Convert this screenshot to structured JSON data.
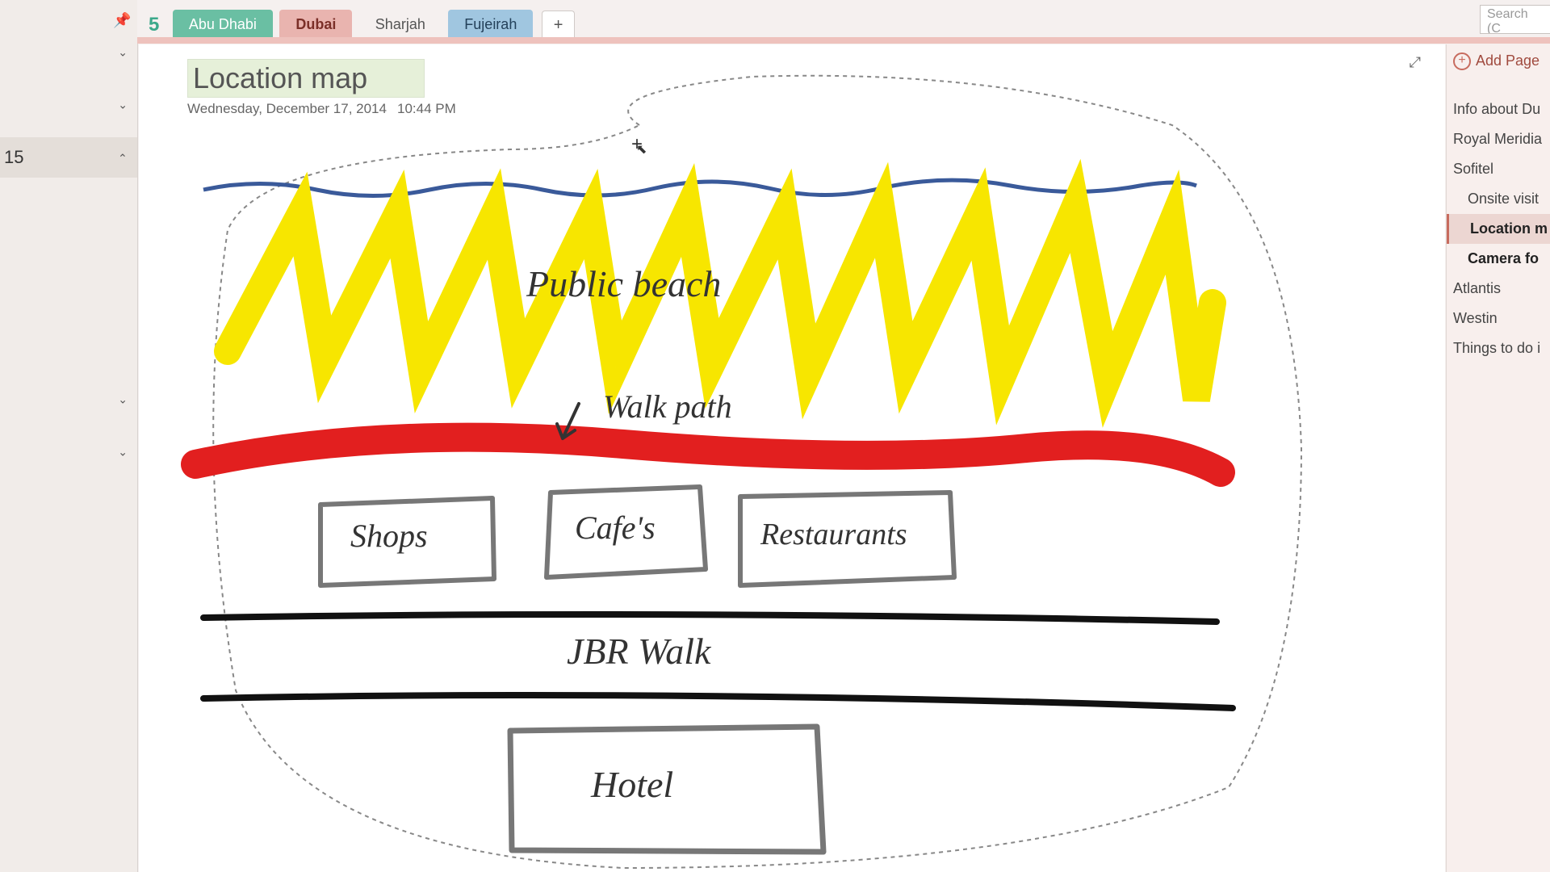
{
  "tabs": {
    "t1": "Abu Dhabi",
    "t2": "Dubai",
    "t3": "Sharjah",
    "t4": "Fujeirah",
    "plus": "+"
  },
  "sidebar": {
    "number": "15"
  },
  "search": {
    "placeholder": "Search (C"
  },
  "add_page": "Add Page",
  "pages": {
    "p1": "Info about Du",
    "p2": "Royal Meridia",
    "p3": "Sofitel",
    "p4": "Onsite visit",
    "p5": "Location m",
    "p6": "Camera fo",
    "p7": "Atlantis",
    "p8": "Westin",
    "p9": "Things to do i"
  },
  "page_title": "Location map",
  "page_date": "Wednesday, December 17, 2014",
  "page_time": "10:44 PM",
  "drawing": {
    "beach": "Public beach",
    "walk": "Walk path",
    "shops": "Shops",
    "cafes": "Cafe's",
    "restaurants": "Restaurants",
    "jbr": "JBR Walk",
    "hotel": "Hotel"
  }
}
